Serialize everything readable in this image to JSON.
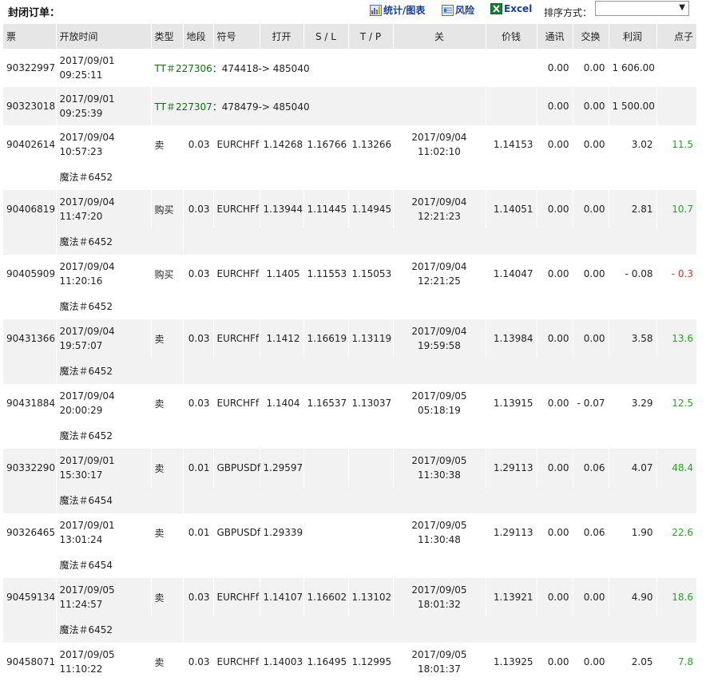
{
  "title": "封闭订单：",
  "toolbar": {
    "stats_label": "统计/图表",
    "risk_label": "风险",
    "excel_label": "Excel",
    "sort_label": "排序方式：",
    "sort_value": ""
  },
  "headers": [
    "票",
    "开放时间",
    "类型",
    "地段",
    "符号",
    "打开",
    "S / L",
    "T / P",
    "关",
    "价钱",
    "通讯",
    "交换",
    "利润",
    "点子"
  ],
  "balance_rows": [
    {
      "ticket": "90322997",
      "open_date": "2017/09/01",
      "open_time": "09:25:11",
      "tt": "TT＃227306",
      "desc": "：474418-> 485040",
      "commission": "0.00",
      "swap": "0.00",
      "profit": "1 606.00"
    },
    {
      "ticket": "90323018",
      "open_date": "2017/09/01",
      "open_time": "09:25:39",
      "tt": "TT＃227307",
      "desc": "：478479-> 485040",
      "commission": "0.00",
      "swap": "0.00",
      "profit": "1 500.00"
    }
  ],
  "orders": [
    {
      "ticket": "90402614",
      "open_date": "2017/09/04",
      "open_time": "10:57:23",
      "type": "卖",
      "lots": "0.03",
      "symbol": "EURCHFf",
      "open_price": "1.14268",
      "sl": "1.16766",
      "tp": "1.13266",
      "close_date": "2017/09/04",
      "close_time": "11:02:10",
      "price": "1.14153",
      "commission": "0.00",
      "swap": "0.00",
      "profit": "3.02",
      "pips": "11.5",
      "magic": "魔法＃6452"
    },
    {
      "ticket": "90406819",
      "open_date": "2017/09/04",
      "open_time": "11:47:20",
      "type": "购买",
      "lots": "0.03",
      "symbol": "EURCHFf",
      "open_price": "1.13944",
      "sl": "1.11445",
      "tp": "1.14945",
      "close_date": "2017/09/04",
      "close_time": "12:21:23",
      "price": "1.14051",
      "commission": "0.00",
      "swap": "0.00",
      "profit": "2.81",
      "pips": "10.7",
      "magic": "魔法＃6452"
    },
    {
      "ticket": "90405909",
      "open_date": "2017/09/04",
      "open_time": "11:20:16",
      "type": "购买",
      "lots": "0.03",
      "symbol": "EURCHFf",
      "open_price": "1.1405",
      "sl": "1.11553",
      "tp": "1.15053",
      "close_date": "2017/09/04",
      "close_time": "12:21:25",
      "price": "1.14047",
      "commission": "0.00",
      "swap": "0.00",
      "profit": "- 0.08",
      "pips": "- 0.3",
      "magic": "魔法＃6452"
    },
    {
      "ticket": "90431366",
      "open_date": "2017/09/04",
      "open_time": "19:57:07",
      "type": "卖",
      "lots": "0.03",
      "symbol": "EURCHFf",
      "open_price": "1.1412",
      "sl": "1.16619",
      "tp": "1.13119",
      "close_date": "2017/09/04",
      "close_time": "19:59:58",
      "price": "1.13984",
      "commission": "0.00",
      "swap": "0.00",
      "profit": "3.58",
      "pips": "13.6",
      "magic": "魔法＃6452"
    },
    {
      "ticket": "90431884",
      "open_date": "2017/09/04",
      "open_time": "20:00:29",
      "type": "卖",
      "lots": "0.03",
      "symbol": "EURCHFf",
      "open_price": "1.1404",
      "sl": "1.16537",
      "tp": "1.13037",
      "close_date": "2017/09/05",
      "close_time": "05:18:19",
      "price": "1.13915",
      "commission": "0.00",
      "swap": "- 0.07",
      "profit": "3.29",
      "pips": "12.5",
      "magic": "魔法＃6452"
    },
    {
      "ticket": "90332290",
      "open_date": "2017/09/01",
      "open_time": "15:30:17",
      "type": "卖",
      "lots": "0.01",
      "symbol": "GBPUSDf",
      "open_price": "1.29597",
      "sl": "",
      "tp": "",
      "close_date": "2017/09/05",
      "close_time": "11:30:38",
      "price": "1.29113",
      "commission": "0.00",
      "swap": "0.06",
      "profit": "4.07",
      "pips": "48.4",
      "magic": "魔法＃6454"
    },
    {
      "ticket": "90326465",
      "open_date": "2017/09/01",
      "open_time": "13:01:24",
      "type": "卖",
      "lots": "0.01",
      "symbol": "GBPUSDf",
      "open_price": "1.29339",
      "sl": "",
      "tp": "",
      "close_date": "2017/09/05",
      "close_time": "11:30:48",
      "price": "1.29113",
      "commission": "0.00",
      "swap": "0.06",
      "profit": "1.90",
      "pips": "22.6",
      "magic": "魔法＃6454"
    },
    {
      "ticket": "90459134",
      "open_date": "2017/09/05",
      "open_time": "11:24:57",
      "type": "卖",
      "lots": "0.03",
      "symbol": "EURCHFf",
      "open_price": "1.14107",
      "sl": "1.16602",
      "tp": "1.13102",
      "close_date": "2017/09/05",
      "close_time": "18:01:32",
      "price": "1.13921",
      "commission": "0.00",
      "swap": "0.00",
      "profit": "4.90",
      "pips": "18.6",
      "magic": "魔法＃6452"
    },
    {
      "ticket": "90458071",
      "open_date": "2017/09/05",
      "open_time": "11:10:22",
      "type": "卖",
      "lots": "0.03",
      "symbol": "EURCHFf",
      "open_price": "1.14003",
      "sl": "1.16495",
      "tp": "1.12995",
      "close_date": "2017/09/05",
      "close_time": "18:01:37",
      "price": "1.13925",
      "commission": "0.00",
      "swap": "0.00",
      "profit": "2.05",
      "pips": "7.8",
      "magic": ""
    }
  ],
  "colors": {
    "header_bg": "#e6e6e6",
    "alt_row_bg": "#f2f2f2",
    "positive": "#2aa02a",
    "negative": "#c0392b",
    "link": "#1a3f8f"
  },
  "icons": {
    "stats": "bar-chart-icon",
    "risk": "risk-chart-icon",
    "excel": "excel-icon",
    "sort": "dropdown-arrow-icon"
  }
}
